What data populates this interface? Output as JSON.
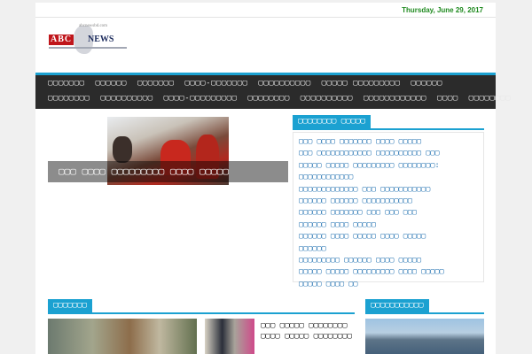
{
  "header": {
    "date": "Thursday, June 29, 2017",
    "logo": {
      "tagline": "abcnewsbd.com",
      "abc": "ABC",
      "news": "NEWS"
    }
  },
  "nav": {
    "row1": [
      "▢▢▢▢▢▢▢",
      "▢▢▢▢▢▢",
      "▢▢▢▢▢▢▢",
      "▢▢▢▢-▢▢▢▢▢▢▢",
      "▢▢▢▢▢▢▢▢▢▢",
      "▢▢▢▢▢ ▢▢▢▢▢▢▢▢▢",
      "▢▢▢▢▢▢"
    ],
    "row2": [
      "▢▢▢▢▢▢▢▢",
      "▢▢▢▢▢▢▢▢▢▢",
      "▢▢▢▢-▢▢▢▢▢▢▢▢▢",
      "▢▢▢▢▢▢▢▢",
      "▢▢▢▢▢▢▢▢▢▢",
      "▢▢▢▢▢▢▢▢▢▢▢▢",
      "▢▢▢▢",
      "▢▢▢▢▢▢▢▢"
    ]
  },
  "slider": {
    "caption": "▢▢▢ ▢▢▢▢ ▢▢▢▢▢▢▢▢▢ ▢▢▢▢ ▢▢▢▢▢"
  },
  "latest": {
    "heading": "▢▢▢▢▢▢▢▢ ▢▢▢▢▢",
    "items": [
      "▢▢▢ ▢▢▢▢ ▢▢▢▢▢▢▢ ▢▢▢▢ ▢▢▢▢▢",
      "▢▢▢ ▢▢▢▢▢▢▢▢▢▢▢▢ ▢▢▢▢▢▢▢▢▢▢ ▢▢▢",
      "▢▢▢▢▢ ▢▢▢▢▢ ▢▢▢▢▢▢▢▢▢ ▢▢▢▢▢▢▢▢:",
      "▢▢▢▢▢▢▢▢▢▢▢▢",
      "▢▢▢▢▢▢▢▢▢▢▢▢▢ ▢▢▢ ▢▢▢▢▢▢▢▢▢▢▢",
      "▢▢▢▢▢▢ ▢▢▢▢▢▢ ▢▢▢▢▢▢▢▢▢▢▢",
      "▢▢▢▢▢▢ ▢▢▢▢▢▢▢ ▢▢▢ ▢▢▢ ▢▢▢",
      "▢▢▢▢▢▢ ▢▢▢▢ ▢▢▢▢▢",
      "▢▢▢▢▢▢ ▢▢▢▢ ▢▢▢▢▢ ▢▢▢▢ ▢▢▢▢▢",
      "▢▢▢▢▢▢",
      "▢▢▢▢▢▢▢▢▢ ▢▢▢▢▢▢ ▢▢▢▢ ▢▢▢▢▢",
      "▢▢▢▢▢ ▢▢▢▢▢ ▢▢▢▢▢▢▢▢▢ ▢▢▢▢ ▢▢▢▢▢",
      "▢▢▢▢▢ ▢▢▢▢ ▢▢",
      "▢▢▢▢ ▢▢▢▢▢ ▢▢ ▢▢▢▢ ▢▢▢▢▢▢▢",
      "▢▢▢▢▢▢▢▢"
    ]
  },
  "sections": {
    "left_heading": "▢▢▢▢▢▢▢",
    "left_story_title": "▢▢▢ ▢▢▢▢▢ ▢▢▢▢▢▢▢▢ ▢▢▢▢ ▢▢▢▢▢ ▢▢▢▢▢▢▢▢",
    "right_heading": "▢▢▢▢▢▢▢▢▢▢▢"
  }
}
